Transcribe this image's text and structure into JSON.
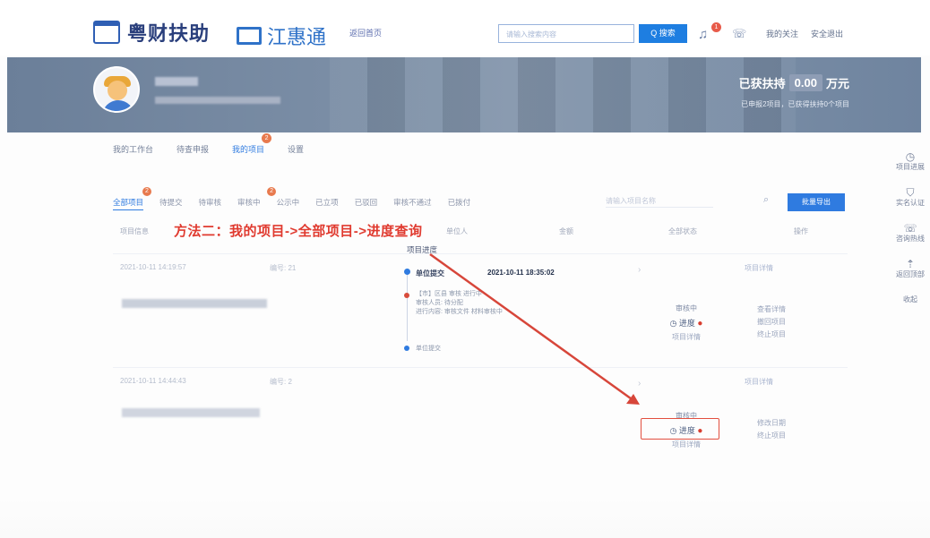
{
  "header": {
    "brand": "粤财扶助",
    "logo2": "江惠通",
    "home_link": "返回首页",
    "search_placeholder": "请输入搜索内容",
    "search_button": "Q 搜索",
    "notification_count": "1",
    "follow_link": "我的关注",
    "logout_link": "安全退出"
  },
  "banner": {
    "support_label": "已获扶持",
    "support_value": "0.00",
    "support_unit": "万元",
    "support_desc": "已申报2项目，已获得扶持0个项目"
  },
  "nav": {
    "items": [
      {
        "label": "我的工作台"
      },
      {
        "label": "待查申报"
      },
      {
        "label": "我的项目",
        "active": true,
        "badge": "2"
      },
      {
        "label": "设置"
      }
    ]
  },
  "filters": {
    "items": [
      {
        "label": "全部项目",
        "active": true,
        "badge": "2"
      },
      {
        "label": "待提交"
      },
      {
        "label": "待审核"
      },
      {
        "label": "审核中",
        "badge": "2"
      },
      {
        "label": "公示中"
      },
      {
        "label": "已立项"
      },
      {
        "label": "已驳回"
      },
      {
        "label": "审核不通过"
      },
      {
        "label": "已拨付"
      }
    ],
    "search_placeholder": "请输入项目名称",
    "batch_button": "批量导出"
  },
  "table": {
    "columns": [
      "项目信息",
      "单位人",
      "金额",
      "全部状态",
      "操作"
    ],
    "rows": [
      {
        "date": "2021-10-11 14:19:57",
        "code": "编号: 21",
        "link": "项目详情",
        "status": "审核中",
        "progress": "进度",
        "detail": "项目详情",
        "actions": [
          "查看详情",
          "撤回项目",
          "终止项目"
        ]
      },
      {
        "date": "2021-10-11 14:44:43",
        "code": "编号: 2",
        "link": "项目详情",
        "status": "审核中",
        "progress": "进度",
        "detail": "项目详情",
        "actions": [
          "修改日期",
          "终止项目"
        ]
      }
    ]
  },
  "popup": {
    "title": "项目进度",
    "step_name": "单位提交",
    "step_time": "2021-10-11 18:35:02",
    "detail_lines": [
      "【市】区县 审核 进行中",
      "审核人员: 待分配",
      "进行内容: 审核文件 材料审核中"
    ],
    "footer": "单位提交"
  },
  "annotation": "方法二：我的项目->全部项目->进度查询",
  "side": {
    "items": [
      {
        "icon": "clock-icon",
        "label": "项目进展"
      },
      {
        "icon": "shield-icon",
        "label": "实名认证"
      },
      {
        "icon": "phone-icon",
        "label": "咨询热线"
      },
      {
        "icon": "top-icon",
        "label": "返回顶部"
      },
      {
        "label": "收起"
      }
    ]
  }
}
